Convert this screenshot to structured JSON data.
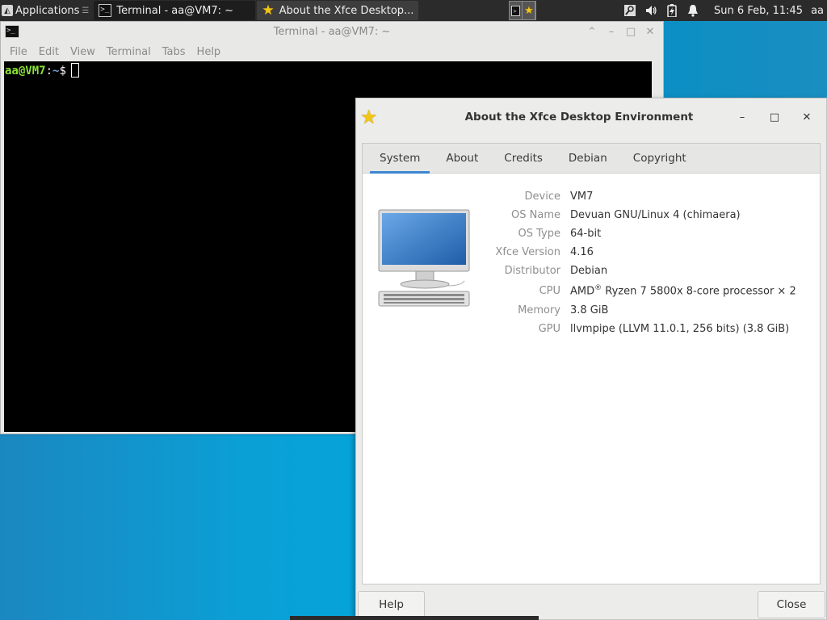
{
  "panel": {
    "applications_label": "Applications",
    "tasks": [
      {
        "label": "Terminal - aa@VM7: ~",
        "icon": "terminal-icon"
      },
      {
        "label": "About the Xfce Desktop...",
        "icon": "star-icon"
      }
    ],
    "clock": "Sun  6 Feb, 11:45",
    "user": "aa",
    "tray_icons": [
      "network-icon",
      "volume-icon",
      "battery-icon",
      "notification-bell-icon"
    ]
  },
  "terminal": {
    "title": "Terminal - aa@VM7: ~",
    "menu": [
      "File",
      "Edit",
      "View",
      "Terminal",
      "Tabs",
      "Help"
    ],
    "prompt_user_host": "aa@VM7",
    "prompt_colon": ":",
    "prompt_path": "~",
    "prompt_symbol": "$"
  },
  "about": {
    "title": "About the Xfce Desktop Environment",
    "tabs": [
      "System",
      "About",
      "Credits",
      "Debian",
      "Copyright"
    ],
    "active_tab": "System",
    "rows": [
      {
        "key": "Device",
        "value": "VM7"
      },
      {
        "key": "OS Name",
        "value": "Devuan GNU/Linux 4 (chimaera)"
      },
      {
        "key": "OS Type",
        "value": "64-bit"
      },
      {
        "key": "Xfce Version",
        "value": "4.16"
      },
      {
        "key": "Distributor",
        "value": "Debian"
      },
      {
        "key": "CPU",
        "value_prefix": "AMD",
        "value_sup": "®",
        "value_suffix": " Ryzen 7 5800x 8-core processor × 2"
      },
      {
        "key": "Memory",
        "value": "3.8 GiB"
      },
      {
        "key": "GPU",
        "value": "llvmpipe (LLVM 11.0.1, 256 bits) (3.8 GiB)"
      }
    ],
    "help_label": "Help",
    "close_label": "Close"
  },
  "colors": {
    "accent": "#3b86d0",
    "prompt_green": "#8ae234",
    "prompt_blue": "#729fcf",
    "panel_bg": "#2b2b2b"
  }
}
